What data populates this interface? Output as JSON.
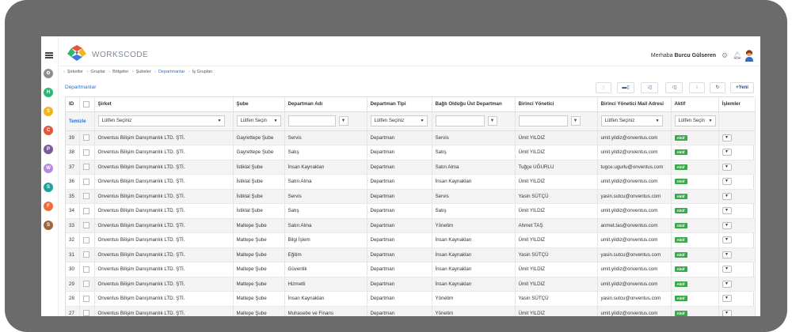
{
  "app": {
    "brand": "WORKSCODE",
    "greeting": "Merhaba",
    "user": "Burcu Gülseren"
  },
  "rail": [
    "H",
    "S",
    "C",
    "P",
    "W",
    "S",
    "F",
    "S"
  ],
  "rail_colors": [
    "#2bb673",
    "#f5b41a",
    "#e4553f",
    "#7a5c9e",
    "#b58be0",
    "#1ea39a",
    "#f26b3a",
    "#a0663c"
  ],
  "breadcrumb": [
    "Şirketler",
    "Gruplar",
    "Bölgeler",
    "Şubeler",
    "Departmanlar",
    "İş Grupları"
  ],
  "page": {
    "title": "Departmanlar"
  },
  "toolbar": {
    "new_label": "+Yeni"
  },
  "columns": [
    "ID",
    "Şirket",
    "Şube",
    "Departman Adı",
    "Departman Tipi",
    "Bağlı Olduğu Üst Departman",
    "Birinci Yönetici",
    "Birinci Yönetici Mail Adresi",
    "Aktif",
    "İşlemler"
  ],
  "filters": {
    "clear_label": "Temizle",
    "placeholder": "Lütfen Seçiniz",
    "placeholder_short": "Lütfen Seçin"
  },
  "badge": "Aktif",
  "rows": [
    {
      "id": "39",
      "company": "Onventus Bilişim Danışmanlık LTD. ŞTİ.",
      "branch": "Gayrettepe Şube",
      "dept": "Servis",
      "type": "Departman",
      "parent": "Servis",
      "manager": "Ümit YILDIZ",
      "email": "umit.yildiz@onventus.com"
    },
    {
      "id": "38",
      "company": "Onventus Bilişim Danışmanlık LTD. ŞTİ.",
      "branch": "Gayrettepe Şube",
      "dept": "Satış",
      "type": "Departman",
      "parent": "Satış",
      "manager": "Ümit YILDIZ",
      "email": "umit.yildiz@onventus.com"
    },
    {
      "id": "37",
      "company": "Onventus Bilişim Danışmanlık LTD. ŞTİ.",
      "branch": "İstiklal Şube",
      "dept": "İnsan Kaynakları",
      "type": "Departman",
      "parent": "Satın Alma",
      "manager": "Tuğçe UĞURLU",
      "email": "tugce.ugurlu@onventus.com"
    },
    {
      "id": "36",
      "company": "Onventus Bilişim Danışmanlık LTD. ŞTİ.",
      "branch": "İstiklal Şube",
      "dept": "Satın Alma",
      "type": "Departman",
      "parent": "İnsan Kaynakları",
      "manager": "Ümit YILDIZ",
      "email": "umit.yildiz@onventus.com"
    },
    {
      "id": "35",
      "company": "Onventus Bilişim Danışmanlık LTD. ŞTİ.",
      "branch": "İstiklal Şube",
      "dept": "Servis",
      "type": "Departman",
      "parent": "Servis",
      "manager": "Yasin SÜTÇÜ",
      "email": "yasin.sutcu@onventus.com"
    },
    {
      "id": "34",
      "company": "Onventus Bilişim Danışmanlık LTD. ŞTİ.",
      "branch": "İstiklal Şube",
      "dept": "Satış",
      "type": "Departman",
      "parent": "Satış",
      "manager": "Ümit YILDIZ",
      "email": "umit.yildiz@onventus.com"
    },
    {
      "id": "33",
      "company": "Onventus Bilişim Danışmanlık LTD. ŞTİ.",
      "branch": "Maltepe Şube",
      "dept": "Satın Alma",
      "type": "Departman",
      "parent": "Yönetim",
      "manager": "Ahmet TAŞ",
      "email": "anmet.tas@onventus.com"
    },
    {
      "id": "32",
      "company": "Onventus Bilişim Danışmanlık LTD. ŞTİ.",
      "branch": "Maltepe Şube",
      "dept": "Bilgi İşlem",
      "type": "Departman",
      "parent": "İnsan Kaynakları",
      "manager": "Ümit YILDIZ",
      "email": "umit.yildiz@onventus.com"
    },
    {
      "id": "31",
      "company": "Onventus Bilişim Danışmanlık LTD. ŞTİ.",
      "branch": "Maltepe Şube",
      "dept": "Eğitim",
      "type": "Departman",
      "parent": "İnsan Kaynakları",
      "manager": "Yasin SÜTÇÜ",
      "email": "yasin.sutcu@onventus.com"
    },
    {
      "id": "30",
      "company": "Onventus Bilişim Danışmanlık LTD. ŞTİ.",
      "branch": "Maltepe Şube",
      "dept": "Güvenlik",
      "type": "Departman",
      "parent": "İnsan Kaynakları",
      "manager": "Ümit YILDIZ",
      "email": "umit.yildiz@onventus.com"
    },
    {
      "id": "29",
      "company": "Onventus Bilişim Danışmanlık LTD. ŞTİ.",
      "branch": "Maltepe Şube",
      "dept": "Hizmetli",
      "type": "Departman",
      "parent": "İnsan Kaynakları",
      "manager": "Ümit YILDIZ",
      "email": "umit.yildiz@onventus.com"
    },
    {
      "id": "28",
      "company": "Onventus Bilişim Danışmanlık LTD. ŞTİ.",
      "branch": "Maltepe Şube",
      "dept": "İnsan Kaynakları",
      "type": "Departman",
      "parent": "Yönetim",
      "manager": "Yasin SÜTÇÜ",
      "email": "yasin.sutcu@onventus.com"
    },
    {
      "id": "27",
      "company": "Onventus Bilişim Danışmanlık LTD. ŞTİ.",
      "branch": "Maltepe Şube",
      "dept": "Muhasebe ve Finans",
      "type": "Departman",
      "parent": "Yönetim",
      "manager": "Ümit YILDIZ",
      "email": "umit.yildiz@onventus.com"
    }
  ]
}
